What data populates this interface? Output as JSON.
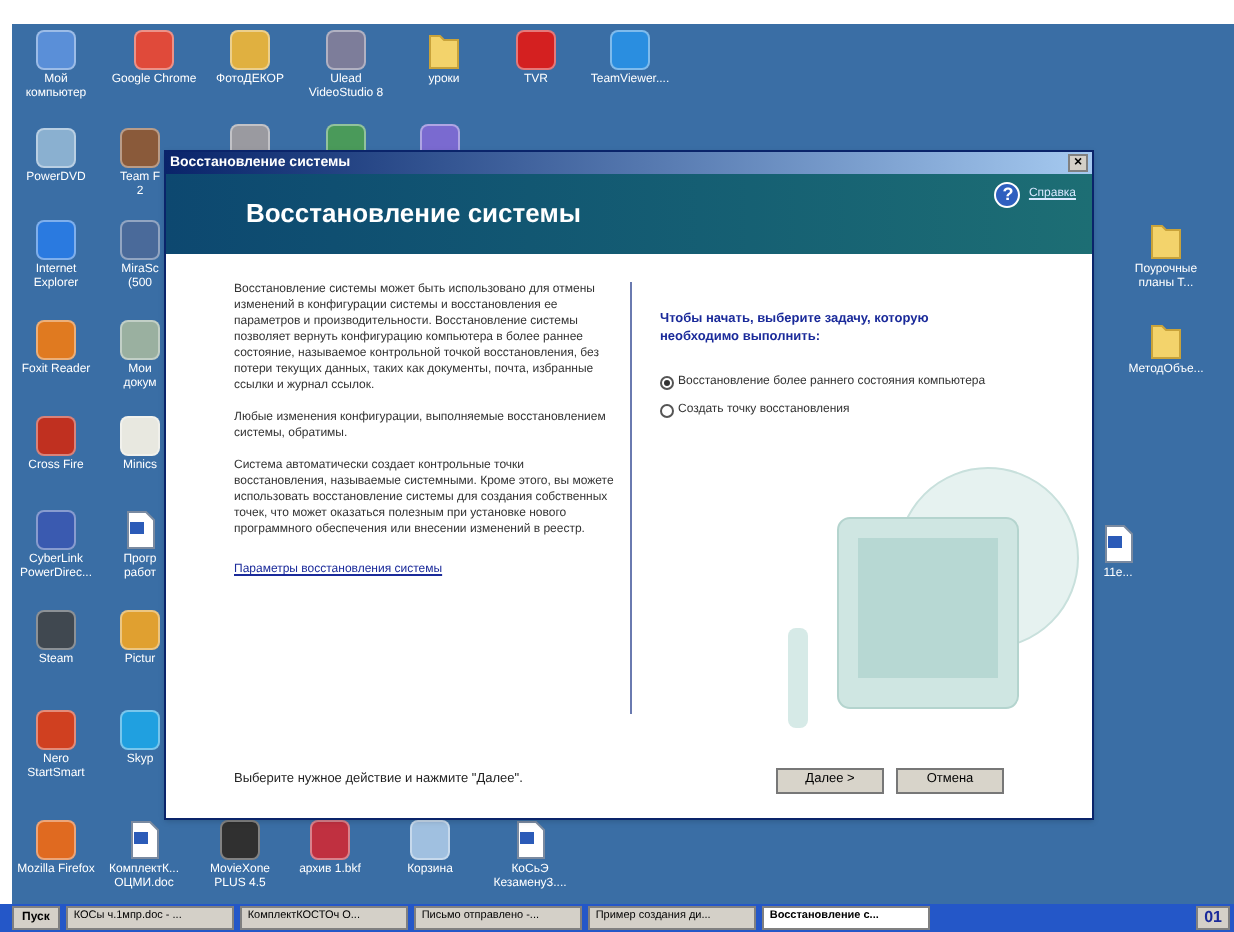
{
  "desktop": {
    "icons": [
      {
        "kind": "app",
        "color": "#5a8fd8",
        "lines": [
          "Мой",
          "компьютер"
        ]
      },
      {
        "kind": "app",
        "color": "#e04a3a",
        "lines": [
          "Google Chrome"
        ]
      },
      {
        "kind": "app",
        "color": "#e0b040",
        "lines": [
          "ФотоДЕКОР"
        ]
      },
      {
        "kind": "app",
        "color": "#7d7d9a",
        "lines": [
          "Ulead",
          "VideoStudio 8"
        ]
      },
      {
        "kind": "folder",
        "lines": [
          "уроки"
        ]
      },
      {
        "kind": "app",
        "color": "#d42020",
        "lines": [
          "TVR"
        ]
      },
      {
        "kind": "app",
        "color": "#2a8ee0",
        "lines": [
          "TeamViewer...."
        ]
      },
      {
        "kind": "app",
        "color": "#8ab0d0",
        "lines": [
          "PowerDVD"
        ]
      },
      {
        "kind": "app",
        "color": "#8a5a3a",
        "lines": [
          "Team F",
          "2"
        ]
      },
      {
        "kind": "app",
        "color": "#9a9aa0"
      },
      {
        "kind": "app",
        "color": "#4a9a5a"
      },
      {
        "kind": "app",
        "color": "#7a6ad0"
      },
      {
        "kind": "app",
        "color": "#2a7ae0",
        "lines": [
          "Internet",
          "Explorer"
        ]
      },
      {
        "kind": "app",
        "color": "#4a6a9a",
        "lines": [
          "MiraSc",
          "(500"
        ]
      },
      {
        "kind": "app",
        "color": "#e07a20",
        "lines": [
          "Foxit Reader"
        ]
      },
      {
        "kind": "app",
        "color": "#9ab0a0",
        "lines": [
          "Мои",
          "докум"
        ]
      },
      {
        "kind": "app",
        "color": "#c03020",
        "lines": [
          "Cross Fire"
        ]
      },
      {
        "kind": "app",
        "color": "#e8e8e0",
        "lines": [
          "Minics"
        ]
      },
      {
        "kind": "app",
        "color": "#3a5ab0",
        "lines": [
          "CyberLink",
          "PowerDirec..."
        ]
      },
      {
        "kind": "document",
        "lines": [
          "Прогр",
          "работ"
        ]
      },
      {
        "kind": "app",
        "color": "#404850",
        "lines": [
          "Steam"
        ]
      },
      {
        "kind": "app",
        "color": "#e0a030",
        "lines": [
          "Pictur"
        ]
      },
      {
        "kind": "app",
        "color": "#d04020",
        "lines": [
          "Nero",
          "StartSmart"
        ]
      },
      {
        "kind": "app",
        "color": "#20a0e0",
        "lines": [
          "Skyp"
        ]
      },
      {
        "kind": "app",
        "color": "#e06a20",
        "lines": [
          "Mozilla Firefox"
        ]
      },
      {
        "kind": "document",
        "lines": [
          "КомплектК...",
          "ОЦМИ.doc"
        ]
      },
      {
        "kind": "app",
        "color": "#303030",
        "lines": [
          "MovieXone",
          "PLUS 4.5"
        ]
      },
      {
        "kind": "app",
        "color": "#c03040",
        "lines": [
          "архив 1.bkf"
        ]
      },
      {
        "kind": "app",
        "color": "#a0c0e0",
        "lines": [
          "Корзина"
        ]
      },
      {
        "kind": "document",
        "lines": [
          "КоСьЭ",
          "Кезамену3...."
        ]
      },
      {
        "kind": "folder",
        "lines": [
          "Поурочные",
          "планы Т..."
        ]
      },
      {
        "kind": "folder",
        "lines": [
          "МетодОбъе..."
        ]
      },
      {
        "kind": "document",
        "lines": [
          "11е..."
        ]
      }
    ]
  },
  "window": {
    "title": "Восстановление системы",
    "close": "×",
    "heading": "Восстановление системы",
    "help": "?",
    "help_link": "Справка",
    "paragraphs": [
      "Восстановление системы может быть использовано для отмены изменений в конфигурации системы и восстановления ее параметров и производительности. Восстановление системы позволяет вернуть конфигурацию компьютера в более раннее состояние, называемое контрольной точкой восстановления, без потери текущих данных, таких как документы, почта, избранные ссылки и журнал ссылок.",
      "Любые изменения конфигурации, выполняемые восстановлением системы, обратимы.",
      "Система автоматически создает контрольные точки восстановления, называемые системными. Кроме этого, вы можете использовать восстановление системы для создания собственных точек, что может оказаться полезным при установке нового программного обеспечения или внесении изменений в реестр."
    ],
    "settings_link": "Параметры восстановления системы",
    "prompt": "Чтобы начать, выберите задачу, которую необходимо выполнить:",
    "options": [
      {
        "label": "Восстановление более раннего состояния компьютера",
        "selected": true
      },
      {
        "label": "Создать точку восстановления",
        "selected": false
      }
    ],
    "footer": "Выберите нужное действие и нажмите \"Далее\".",
    "buttons": [
      "Далее >",
      "Отмена"
    ]
  },
  "taskbar": {
    "start": "Пуск",
    "tasks": [
      {
        "label": "КОСы ч.1мпр.doc - ...",
        "selected": false
      },
      {
        "label": "КомплектКОСТОч О...",
        "selected": false
      },
      {
        "label": "Письмо отправлено -...",
        "selected": false
      },
      {
        "label": "Пример создания ди...",
        "selected": false
      },
      {
        "label": "Восстановление с...",
        "selected": true
      }
    ],
    "clock": "01"
  }
}
